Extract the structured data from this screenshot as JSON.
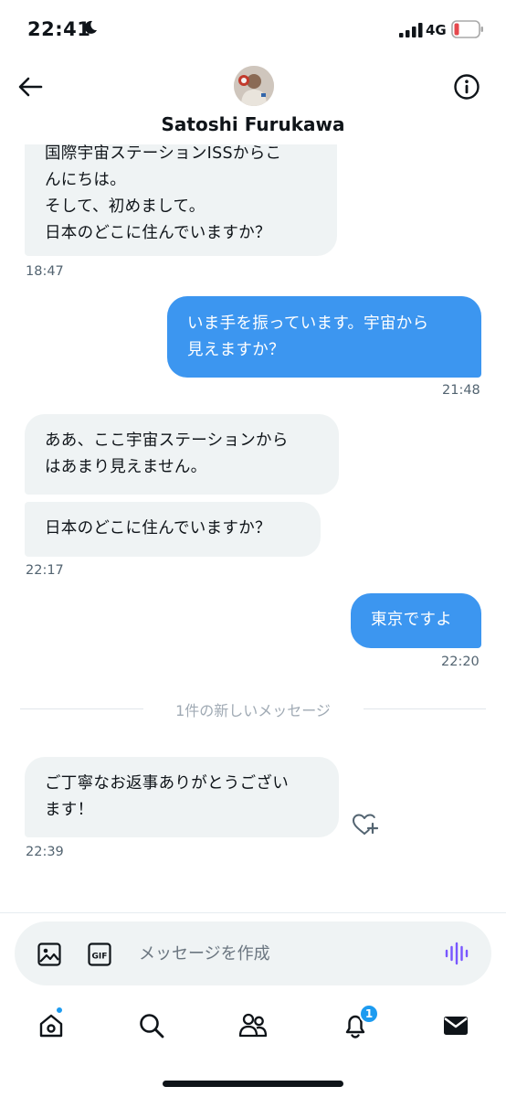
{
  "status_bar": {
    "time": "22:41",
    "network": "4G",
    "battery_color": "#e5484d"
  },
  "header": {
    "contact_name": "Satoshi Furukawa"
  },
  "messages": [
    {
      "direction": "in",
      "text": "国際宇宙ステーションISSからこ\nんにちは。\nそして、初めまして。\n日本のどこに住んでいますか？"
    },
    {
      "direction": "in",
      "time": "18:47"
    },
    {
      "direction": "out",
      "text": "いま手を振っています。宇宙から\n見えますか？",
      "time": "21:48"
    },
    {
      "direction": "in",
      "text": "ああ、ここ宇宙ステーションから\nはあまり見えません。"
    },
    {
      "direction": "in",
      "text": "日本のどこに住んでいますか？",
      "time": "22:17"
    },
    {
      "direction": "out",
      "text": "東京ですよ",
      "time": "22:20"
    },
    {
      "direction": "in",
      "text": "ご丁寧なお返事ありがとうござい\nます！",
      "time": "22:39"
    }
  ],
  "divider": {
    "text": "1件の新しいメッセージ"
  },
  "compose": {
    "placeholder": "メッセージを作成"
  },
  "tabbar": {
    "notification_count": "1"
  },
  "colors": {
    "accent": "#1d9bf0",
    "outgoing_bubble": "#3c96f0",
    "incoming_bubble": "#eff3f4",
    "voice_icon": "#7856ff"
  }
}
